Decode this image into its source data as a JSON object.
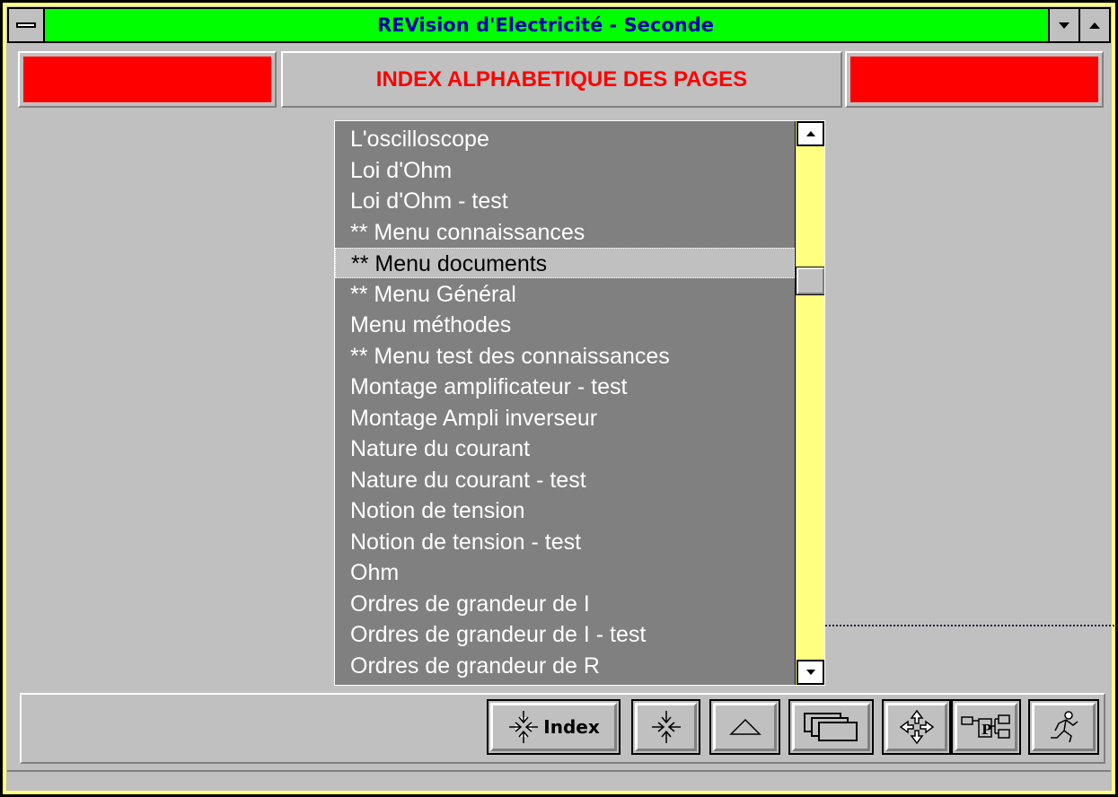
{
  "window": {
    "title": "REVision d'Electricité - Seconde",
    "accent_color": "#00ff00",
    "title_color": "#0000a8"
  },
  "header": {
    "title": "INDEX ALPHABETIQUE DES PAGES",
    "title_color": "#ff0000",
    "side_block_color": "#ff0000"
  },
  "index_list": {
    "items": [
      "L'oscilloscope",
      "Loi d'Ohm",
      "Loi d'Ohm - test",
      "** Menu connaissances",
      "** Menu documents",
      "** Menu Général",
      "Menu méthodes",
      "** Menu test des connaissances",
      "Montage amplificateur - test",
      "Montage Ampli inverseur",
      "Nature du courant",
      "Nature du courant - test",
      "Notion de tension",
      "Notion de tension - test",
      "Ohm",
      "Ordres de grandeur de I",
      "Ordres de grandeur de I - test",
      "Ordres de grandeur de R"
    ],
    "selected": "** Menu documents"
  },
  "toolbar": {
    "index_label": "Index",
    "buttons": [
      {
        "name": "index-button",
        "icon": "contract-arrows-icon"
      },
      {
        "name": "contract-button",
        "icon": "contract-arrows-icon"
      },
      {
        "name": "up-button",
        "icon": "triangle-up-icon"
      },
      {
        "name": "windows-button",
        "icon": "stacked-windows-icon"
      },
      {
        "name": "expand-button",
        "icon": "expand-arrows-icon"
      },
      {
        "name": "page-map-button",
        "icon": "page-map-icon"
      },
      {
        "name": "exit-button",
        "icon": "running-man-icon"
      }
    ]
  }
}
